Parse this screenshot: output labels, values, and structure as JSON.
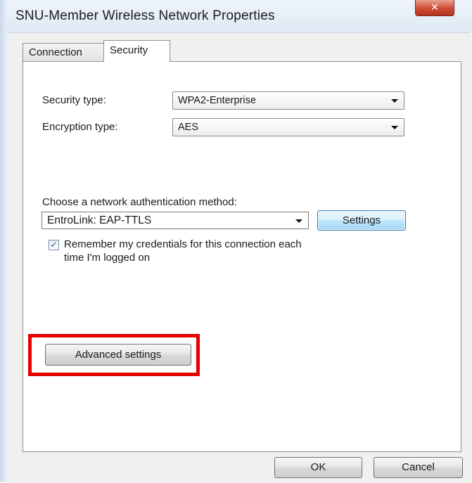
{
  "window": {
    "title": "SNU-Member Wireless Network Properties",
    "close_glyph": "✕"
  },
  "tabs": [
    {
      "label": "Connection",
      "selected": false
    },
    {
      "label": "Security",
      "selected": true
    }
  ],
  "security": {
    "security_type_label": "Security type:",
    "security_type_value": "WPA2-Enterprise",
    "encryption_type_label": "Encryption type:",
    "encryption_type_value": "AES",
    "auth_method_label": "Choose a network authentication method:",
    "auth_method_value": "EntroLink: EAP-TTLS",
    "settings_button": "Settings",
    "remember_checked": true,
    "remember_line1": "Remember my credentials for this connection each",
    "remember_line2": "time I'm logged on",
    "advanced_button": "Advanced settings"
  },
  "footer": {
    "ok": "OK",
    "cancel": "Cancel"
  },
  "colors": {
    "highlight": "#e60000",
    "close_button": "#cf4a35",
    "settings_button": "#bee6fd"
  },
  "icons": {
    "dropdown": "chevron-down-icon",
    "checkbox": "checkmark-icon",
    "close": "close-icon"
  }
}
